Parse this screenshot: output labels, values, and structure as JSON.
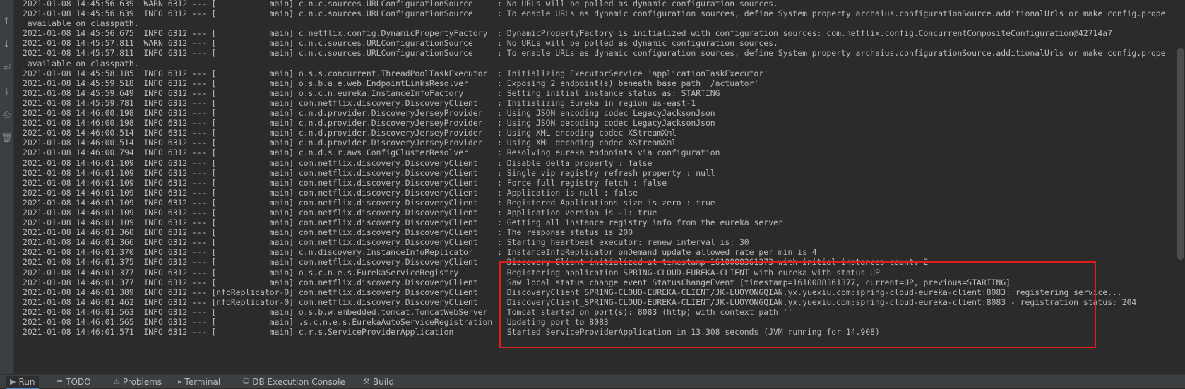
{
  "toolbar": {
    "buttons": [
      {
        "name": "up-arrow-icon",
        "glyph": "↑"
      },
      {
        "name": "down-arrow-icon",
        "glyph": "↓"
      },
      {
        "name": "soft-wrap-icon",
        "glyph": "⏎"
      },
      {
        "name": "scroll-to-end-icon",
        "glyph": "⤓"
      },
      {
        "name": "print-icon",
        "glyph": "⎙"
      },
      {
        "name": "trash-icon",
        "glyph": "🗑"
      }
    ]
  },
  "log": [
    "2021-01-08 14:45:56.639  WARN 6312 --- [           main] c.n.c.sources.URLConfigurationSource     : No URLs will be polled as dynamic configuration sources.",
    "2021-01-08 14:45:56.639  INFO 6312 --- [           main] c.n.c.sources.URLConfigurationSource     : To enable URLs as dynamic configuration sources, define System property archaius.configurationSource.additionalUrls or make config.prope",
    " available on classpath.",
    "2021-01-08 14:45:56.675  INFO 6312 --- [           main] c.netflix.config.DynamicPropertyFactory  : DynamicPropertyFactory is initialized with configuration sources: com.netflix.config.ConcurrentCompositeConfiguration@42714a7",
    "2021-01-08 14:45:57.811  WARN 6312 --- [           main] c.n.c.sources.URLConfigurationSource     : No URLs will be polled as dynamic configuration sources.",
    "2021-01-08 14:45:57.811  INFO 6312 --- [           main] c.n.c.sources.URLConfigurationSource     : To enable URLs as dynamic configuration sources, define System property archaius.configurationSource.additionalUrls or make config.prope",
    " available on classpath.",
    "2021-01-08 14:45:58.185  INFO 6312 --- [           main] o.s.s.concurrent.ThreadPoolTaskExecutor  : Initializing ExecutorService 'applicationTaskExecutor'",
    "2021-01-08 14:45:59.518  INFO 6312 --- [           main] o.s.b.a.e.web.EndpointLinksResolver      : Exposing 2 endpoint(s) beneath base path '/actuator'",
    "2021-01-08 14:45:59.649  INFO 6312 --- [           main] o.s.c.n.eureka.InstanceInfoFactory       : Setting initial instance status as: STARTING",
    "2021-01-08 14:45:59.781  INFO 6312 --- [           main] com.netflix.discovery.DiscoveryClient    : Initializing Eureka in region us-east-1",
    "2021-01-08 14:46:00.198  INFO 6312 --- [           main] c.n.d.provider.DiscoveryJerseyProvider   : Using JSON encoding codec LegacyJacksonJson",
    "2021-01-08 14:46:00.198  INFO 6312 --- [           main] c.n.d.provider.DiscoveryJerseyProvider   : Using JSON decoding codec LegacyJacksonJson",
    "2021-01-08 14:46:00.514  INFO 6312 --- [           main] c.n.d.provider.DiscoveryJerseyProvider   : Using XML encoding codec XStreamXml",
    "2021-01-08 14:46:00.514  INFO 6312 --- [           main] c.n.d.provider.DiscoveryJerseyProvider   : Using XML decoding codec XStreamXml",
    "2021-01-08 14:46:00.794  INFO 6312 --- [           main] c.n.d.s.r.aws.ConfigClusterResolver      : Resolving eureka endpoints via configuration",
    "2021-01-08 14:46:01.109  INFO 6312 --- [           main] com.netflix.discovery.DiscoveryClient    : Disable delta property : false",
    "2021-01-08 14:46:01.109  INFO 6312 --- [           main] com.netflix.discovery.DiscoveryClient    : Single vip registry refresh property : null",
    "2021-01-08 14:46:01.109  INFO 6312 --- [           main] com.netflix.discovery.DiscoveryClient    : Force full registry fetch : false",
    "2021-01-08 14:46:01.109  INFO 6312 --- [           main] com.netflix.discovery.DiscoveryClient    : Application is null : false",
    "2021-01-08 14:46:01.109  INFO 6312 --- [           main] com.netflix.discovery.DiscoveryClient    : Registered Applications size is zero : true",
    "2021-01-08 14:46:01.109  INFO 6312 --- [           main] com.netflix.discovery.DiscoveryClient    : Application version is -1: true",
    "2021-01-08 14:46:01.109  INFO 6312 --- [           main] com.netflix.discovery.DiscoveryClient    : Getting all instance registry info from the eureka server",
    "2021-01-08 14:46:01.360  INFO 6312 --- [           main] com.netflix.discovery.DiscoveryClient    : The response status is 200",
    "2021-01-08 14:46:01.366  INFO 6312 --- [           main] com.netflix.discovery.DiscoveryClient    : Starting heartbeat executor: renew interval is: 30",
    "2021-01-08 14:46:01.370  INFO 6312 --- [           main] c.n.discovery.InstanceInfoReplicator     : InstanceInfoReplicator onDemand update allowed rate per min is 4",
    "2021-01-08 14:46:01.375  INFO 6312 --- [           main] com.netflix.discovery.DiscoveryClient    : Discovery Client initialized at timestamp 1610088361373 with initial instances count: 2",
    "2021-01-08 14:46:01.377  INFO 6312 --- [           main] o.s.c.n.e.s.EurekaServiceRegistry        : Registering application SPRING-CLOUD-EUREKA-CLIENT with eureka with status UP",
    "2021-01-08 14:46:01.377  INFO 6312 --- [           main] com.netflix.discovery.DiscoveryClient    : Saw local status change event StatusChangeEvent [timestamp=1610088361377, current=UP, previous=STARTING]",
    "2021-01-08 14:46:01.389  INFO 6312 --- [nfoReplicator-0] com.netflix.discovery.DiscoveryClient    : DiscoveryClient_SPRING-CLOUD-EUREKA-CLIENT/JK-LUOYONGQIAN.yx.yuexiu.com:spring-cloud-eureka-client:8083: registering service...",
    "2021-01-08 14:46:01.462  INFO 6312 --- [nfoReplicator-0] com.netflix.discovery.DiscoveryClient    : DiscoveryClient_SPRING-CLOUD-EUREKA-CLIENT/JK-LUOYONGQIAN.yx.yuexiu.com:spring-cloud-eureka-client:8083 - registration status: 204",
    "2021-01-08 14:46:01.563  INFO 6312 --- [           main] o.s.b.w.embedded.tomcat.TomcatWebServer  : Tomcat started on port(s): 8083 (http) with context path ''",
    "2021-01-08 14:46:01.565  INFO 6312 --- [           main] .s.c.n.e.s.EurekaAutoServiceRegistration : Updating port to 8083",
    "2021-01-08 14:46:01.571  INFO 6312 --- [           main] c.r.s.ServiceProviderApplication         : Started ServiceProviderApplication in 13.308 seconds (JVM running for 14.908)"
  ],
  "bottom_tabs": [
    {
      "label": "Run",
      "icon": "play-icon",
      "glyph": "▶",
      "active": true
    },
    {
      "label": "TODO",
      "icon": "list-icon",
      "glyph": "≡",
      "active": false
    },
    {
      "label": "Problems",
      "icon": "problems-icon",
      "glyph": "⚠",
      "active": false
    },
    {
      "label": "Terminal",
      "icon": "terminal-icon",
      "glyph": "▸",
      "active": false
    },
    {
      "label": "DB Execution Console",
      "icon": "database-icon",
      "glyph": "⛁",
      "active": false
    },
    {
      "label": "Build",
      "icon": "hammer-icon",
      "glyph": "⚒",
      "active": false
    }
  ],
  "colors": {
    "background": "#2b2b2b",
    "text": "#bbbbbb",
    "highlight_border": "#e01d1d"
  }
}
